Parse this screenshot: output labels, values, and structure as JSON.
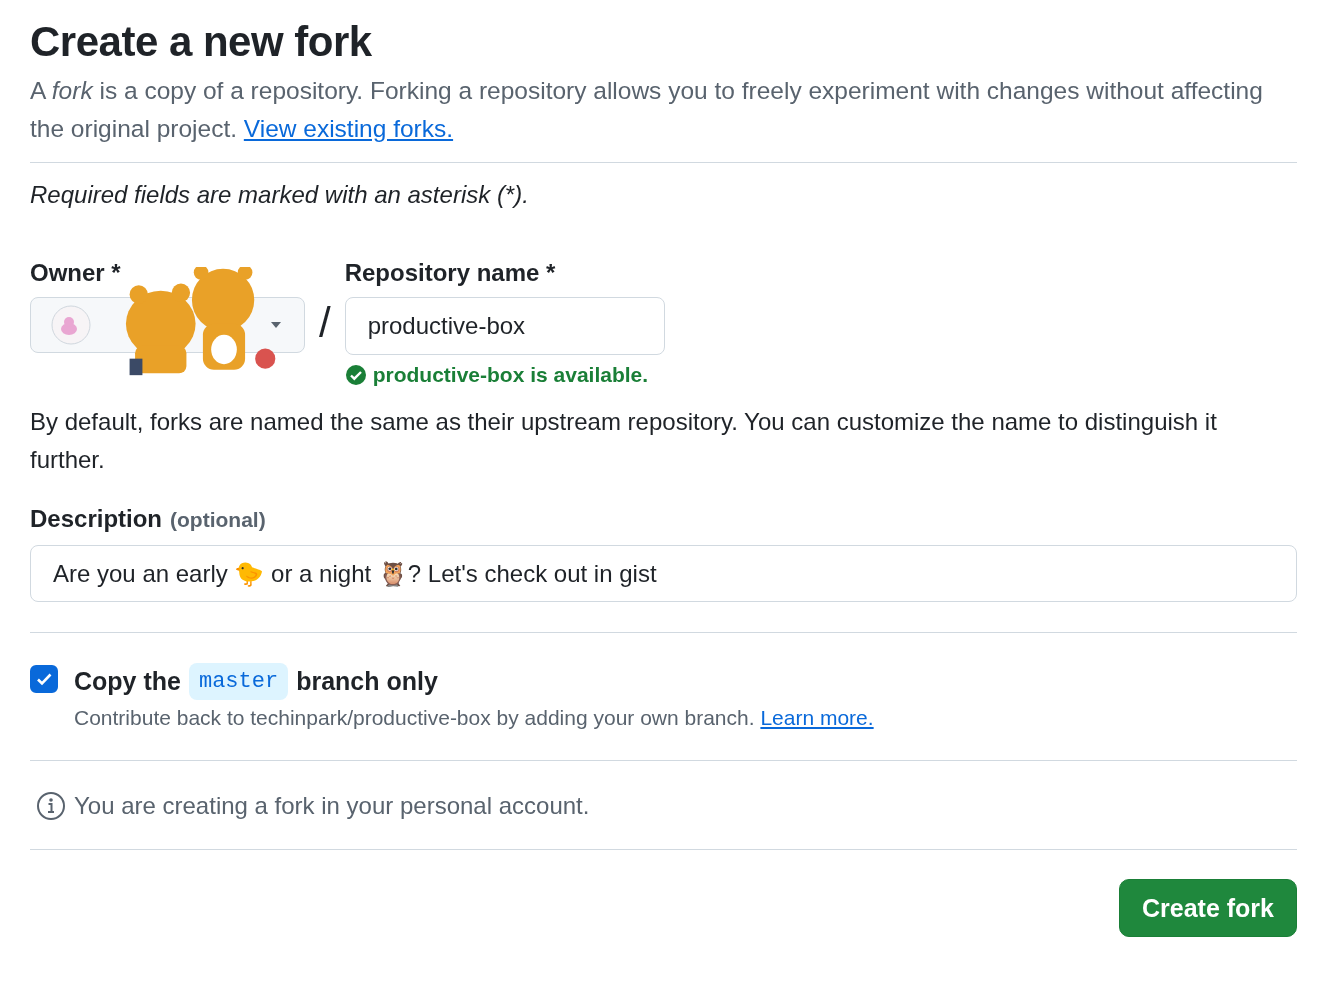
{
  "header": {
    "title": "Create a new fork",
    "intro_parts": [
      "A ",
      "fork",
      " is a copy of a repository. Forking a repository allows you to freely experiment with changes without affecting the original project. "
    ],
    "intro_link": "View existing forks."
  },
  "required_note": "Required fields are marked with an asterisk (*).",
  "owner": {
    "label": "Owner *"
  },
  "separator": "/",
  "repository": {
    "label": "Repository name *",
    "value": "productive-box",
    "available": true,
    "status": "productive-box is available."
  },
  "default_note": "By default, forks are named the same as their upstream repository. You can customize the name to distinguish it further.",
  "description": {
    "label": "Description",
    "hint": "(optional)",
    "value": "Are you an early 🐤 or a night 🦉? Let's check out in gist"
  },
  "copy_branch": {
    "checked": true,
    "label_before": "Copy the",
    "branch": "master",
    "label_after": "branch only",
    "help": "Contribute back to techinpark/productive-box by adding your own branch.",
    "link": "Learn more."
  },
  "notice": "You are creating a fork in your personal account.",
  "submit": "Create fork"
}
